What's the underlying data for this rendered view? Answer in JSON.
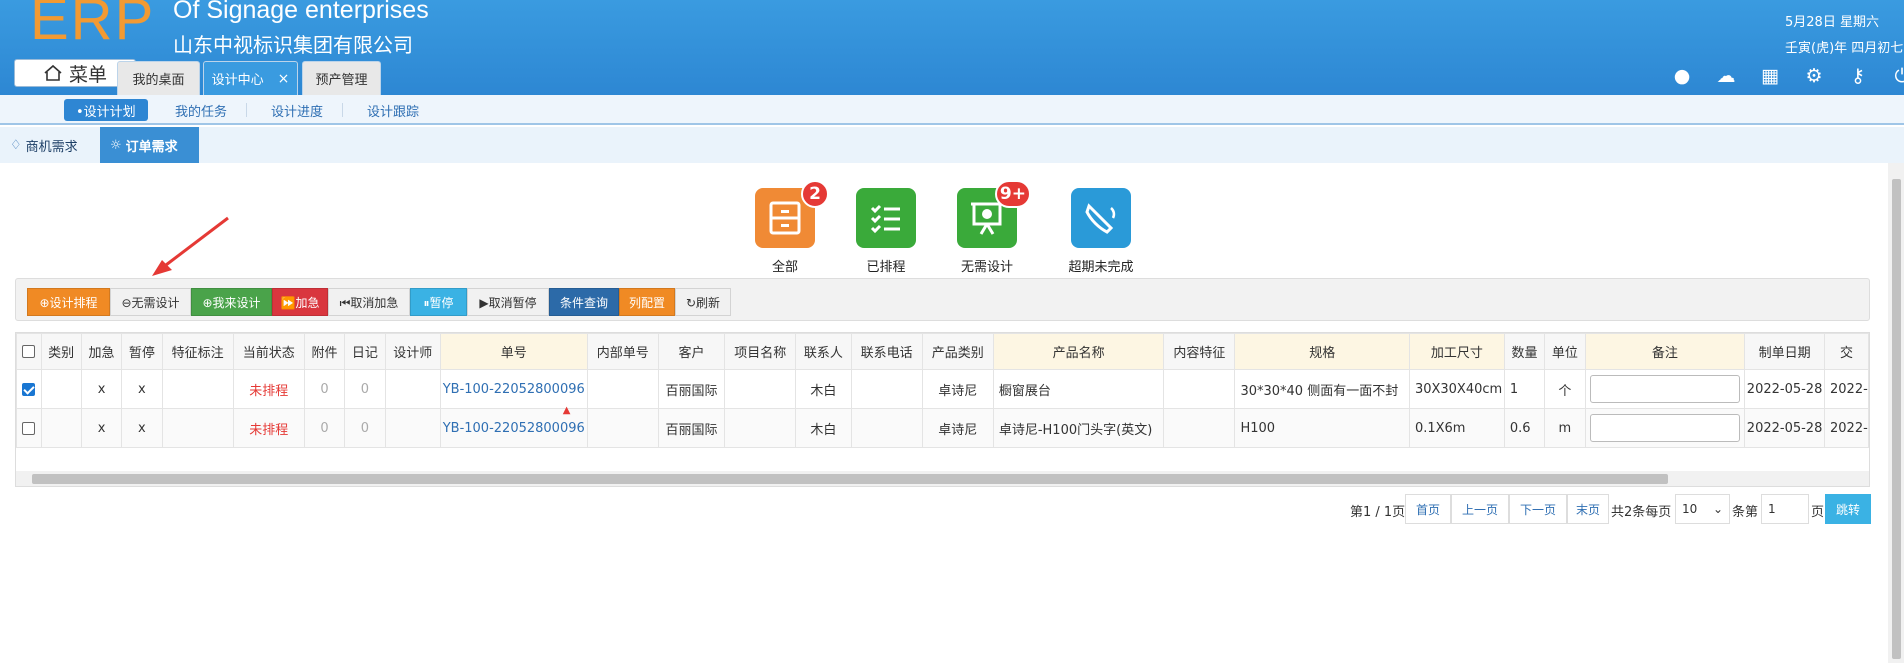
{
  "header": {
    "logo": "ERP",
    "company_en": "Of Signage enterprises",
    "company_cn": "山东中视标识集团有限公司",
    "menu_label": "菜单",
    "tabs": [
      {
        "label": "我的桌面"
      },
      {
        "label": "设计中心"
      },
      {
        "label": "预产管理"
      }
    ],
    "tab_close": "×",
    "date_line1": "5月28日 星期六",
    "date_line2": "壬寅(虎)年 四月初七"
  },
  "subnav": {
    "items": [
      {
        "label": "•设计计划"
      },
      {
        "label": "我的任务"
      },
      {
        "label": "设计进度"
      },
      {
        "label": "设计跟踪"
      }
    ]
  },
  "level3": {
    "tabs": [
      {
        "label": "商机需求"
      },
      {
        "label": "订单需求"
      }
    ]
  },
  "summary": {
    "items": [
      {
        "label": "全部",
        "badge": "2",
        "color": "#f08a35",
        "icon": "drawer-icon"
      },
      {
        "label": "已排程",
        "badge": "",
        "color": "#3aaa3a",
        "icon": "checklist-icon"
      },
      {
        "label": "无需设计",
        "badge": "9+",
        "color": "#3aaa3a",
        "icon": "presentation-icon"
      },
      {
        "label": "超期未完成",
        "badge": "",
        "color": "#2a9ad8",
        "icon": "bell-icon"
      }
    ]
  },
  "toolbar": {
    "buttons": [
      {
        "label": "⊕设计排程",
        "color": "#f08a24"
      },
      {
        "label": "⊖无需设计",
        "color": "#f1f1f1"
      },
      {
        "label": "⊕我来设计",
        "color": "#4aa34a"
      },
      {
        "label": "⏩加急",
        "color": "#d9363e"
      },
      {
        "label": "⏮取消加急",
        "color": "#f1f1f1"
      },
      {
        "label": "⏸暂停",
        "color": "#3ab2e4"
      },
      {
        "label": "▶取消暂停",
        "color": "#f1f1f1"
      },
      {
        "label": "条件查询",
        "color": "#2c6aa8"
      },
      {
        "label": "列配置",
        "color": "#f08a24"
      },
      {
        "label": "↻刷新",
        "color": "#f1f1f1"
      }
    ]
  },
  "table": {
    "columns": [
      "类别",
      "加急",
      "暂停",
      "特征标注",
      "当前状态",
      "附件",
      "日记",
      "设计师",
      "单号",
      "内部单号",
      "客户",
      "项目名称",
      "联系人",
      "联系电话",
      "产品类别",
      "产品名称",
      "内容特征",
      "规格",
      "加工尺寸",
      "数量",
      "单位",
      "备注",
      "制单日期",
      "交"
    ],
    "rows": [
      {
        "checked": true,
        "cells": [
          "",
          "x",
          "x",
          "",
          "未排程",
          "0",
          "0",
          "",
          "YB-100-22052800096",
          "",
          "百丽国际",
          "",
          "木白",
          "",
          "卓诗尼",
          "橱窗展台",
          "",
          "30*30*40 侧面有一面不封",
          "30X30X40cm",
          "1",
          "个",
          "",
          "2022-05-28",
          "2022-"
        ]
      },
      {
        "checked": false,
        "cells": [
          "",
          "x",
          "x",
          "",
          "未排程",
          "0",
          "0",
          "",
          "YB-100-22052800096",
          "",
          "百丽国际",
          "",
          "木白",
          "",
          "卓诗尼",
          "卓诗尼-H100门头字(英文)",
          "",
          "H100",
          "0.1X6m",
          "0.6",
          "m",
          "",
          "2022-05-28",
          "2022-"
        ]
      }
    ]
  },
  "pager": {
    "page_info": "第1 / 1页",
    "first": "首页",
    "prev": "上一页",
    "next": "下一页",
    "last": "末页",
    "total": "共2条每页",
    "page_size": "10",
    "per_unit": "条第",
    "goto_value": "1",
    "page_unit": "页",
    "goto": "跳转"
  }
}
